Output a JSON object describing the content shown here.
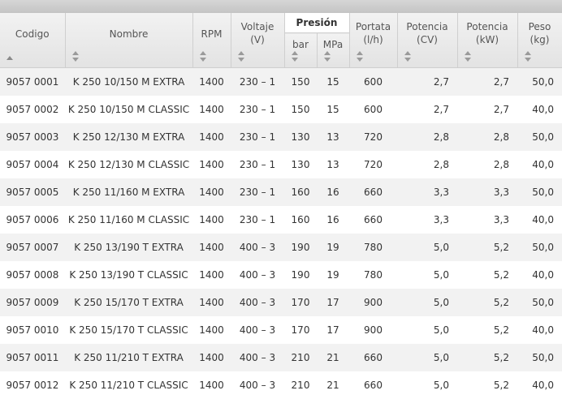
{
  "headers": {
    "codigo": "Codigo",
    "nombre": "Nombre",
    "rpm": "RPM",
    "voltaje": "Voltaje",
    "voltaje_unit": "(V)",
    "presion": "Presión",
    "bar": "bar",
    "mpa": "MPa",
    "portata": "Portata",
    "portata_unit": "(l/h)",
    "potencia_cv": "Potencia",
    "potencia_cv_unit": "(CV)",
    "potencia_kw": "Potencia",
    "potencia_kw_unit": "(kW)",
    "peso": "Peso",
    "peso_unit": "(kg)"
  },
  "rows": [
    {
      "codigo": "9057 0001",
      "nombre": "K 250 10/150 M EXTRA",
      "rpm": "1400",
      "voltaje": "230 – 1",
      "bar": "150",
      "mpa": "15",
      "portata": "600",
      "cv": "2,7",
      "kw": "2,7",
      "peso": "50,0"
    },
    {
      "codigo": "9057 0002",
      "nombre": "K 250 10/150 M CLASSIC",
      "rpm": "1400",
      "voltaje": "230 – 1",
      "bar": "150",
      "mpa": "15",
      "portata": "600",
      "cv": "2,7",
      "kw": "2,7",
      "peso": "40,0"
    },
    {
      "codigo": "9057 0003",
      "nombre": "K 250 12/130 M EXTRA",
      "rpm": "1400",
      "voltaje": "230 – 1",
      "bar": "130",
      "mpa": "13",
      "portata": "720",
      "cv": "2,8",
      "kw": "2,8",
      "peso": "50,0"
    },
    {
      "codigo": "9057 0004",
      "nombre": "K 250 12/130 M CLASSIC",
      "rpm": "1400",
      "voltaje": "230 – 1",
      "bar": "130",
      "mpa": "13",
      "portata": "720",
      "cv": "2,8",
      "kw": "2,8",
      "peso": "40,0"
    },
    {
      "codigo": "9057 0005",
      "nombre": "K 250 11/160 M EXTRA",
      "rpm": "1400",
      "voltaje": "230 – 1",
      "bar": "160",
      "mpa": "16",
      "portata": "660",
      "cv": "3,3",
      "kw": "3,3",
      "peso": "50,0"
    },
    {
      "codigo": "9057 0006",
      "nombre": "K 250 11/160 M CLASSIC",
      "rpm": "1400",
      "voltaje": "230 – 1",
      "bar": "160",
      "mpa": "16",
      "portata": "660",
      "cv": "3,3",
      "kw": "3,3",
      "peso": "40,0"
    },
    {
      "codigo": "9057 0007",
      "nombre": "K 250 13/190 T EXTRA",
      "rpm": "1400",
      "voltaje": "400 – 3",
      "bar": "190",
      "mpa": "19",
      "portata": "780",
      "cv": "5,0",
      "kw": "5,2",
      "peso": "50,0"
    },
    {
      "codigo": "9057 0008",
      "nombre": "K 250 13/190 T CLASSIC",
      "rpm": "1400",
      "voltaje": "400 – 3",
      "bar": "190",
      "mpa": "19",
      "portata": "780",
      "cv": "5,0",
      "kw": "5,2",
      "peso": "40,0"
    },
    {
      "codigo": "9057 0009",
      "nombre": "K 250 15/170 T EXTRA",
      "rpm": "1400",
      "voltaje": "400 – 3",
      "bar": "170",
      "mpa": "17",
      "portata": "900",
      "cv": "5,0",
      "kw": "5,2",
      "peso": "50,0"
    },
    {
      "codigo": "9057 0010",
      "nombre": "K 250 15/170 T CLASSIC",
      "rpm": "1400",
      "voltaje": "400 – 3",
      "bar": "170",
      "mpa": "17",
      "portata": "900",
      "cv": "5,0",
      "kw": "5,2",
      "peso": "40,0"
    },
    {
      "codigo": "9057 0011",
      "nombre": "K 250 11/210 T EXTRA",
      "rpm": "1400",
      "voltaje": "400 – 3",
      "bar": "210",
      "mpa": "21",
      "portata": "660",
      "cv": "5,0",
      "kw": "5,2",
      "peso": "50,0"
    },
    {
      "codigo": "9057 0012",
      "nombre": "K 250 11/210 T CLASSIC",
      "rpm": "1400",
      "voltaje": "400 – 3",
      "bar": "210",
      "mpa": "21",
      "portata": "660",
      "cv": "5,0",
      "kw": "5,2",
      "peso": "40,0"
    }
  ]
}
